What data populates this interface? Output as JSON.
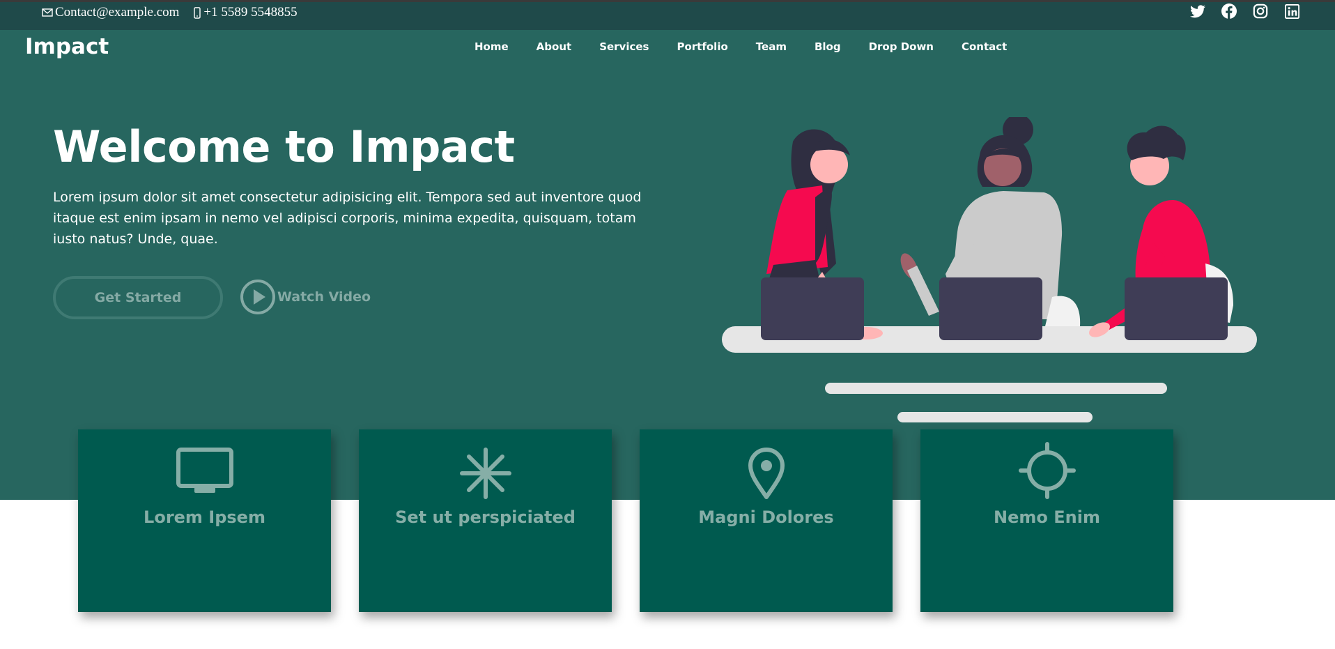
{
  "topbar": {
    "email": "Contact@example.com",
    "phone": "+1 5589 5548855",
    "social": [
      "twitter-icon",
      "facebook-icon",
      "instagram-icon",
      "linkedin-icon"
    ]
  },
  "header": {
    "logo": "Impact",
    "nav": [
      "Home",
      "About",
      "Services",
      "Portfolio",
      "Team",
      "Blog",
      "Drop Down",
      "Contact"
    ]
  },
  "hero": {
    "title": "Welcome to Impact",
    "text": "Lorem ipsum dolor sit amet consectetur adipisicing elit. Tempora sed aut inventore quod itaque est enim ipsam in nemo vel adipisci corporis, minima expedita, quisquam, totam iusto natus? Unde, quae.",
    "get_started": "Get Started",
    "watch_video": "Watch Video"
  },
  "cards": [
    {
      "icon": "monitor-icon",
      "title": "Lorem Ipsem"
    },
    {
      "icon": "snowflake-icon",
      "title": "Set ut perspiciated"
    },
    {
      "icon": "map-pin-icon",
      "title": "Magni Dolores"
    },
    {
      "icon": "crosshair-icon",
      "title": "Nemo Enim"
    }
  ],
  "colors": {
    "topbar": "#1f4a4a",
    "hero": "#27665f",
    "card": "#005a4f",
    "accent_pink": "#f50a4f",
    "muted_text": "#86aea7"
  }
}
